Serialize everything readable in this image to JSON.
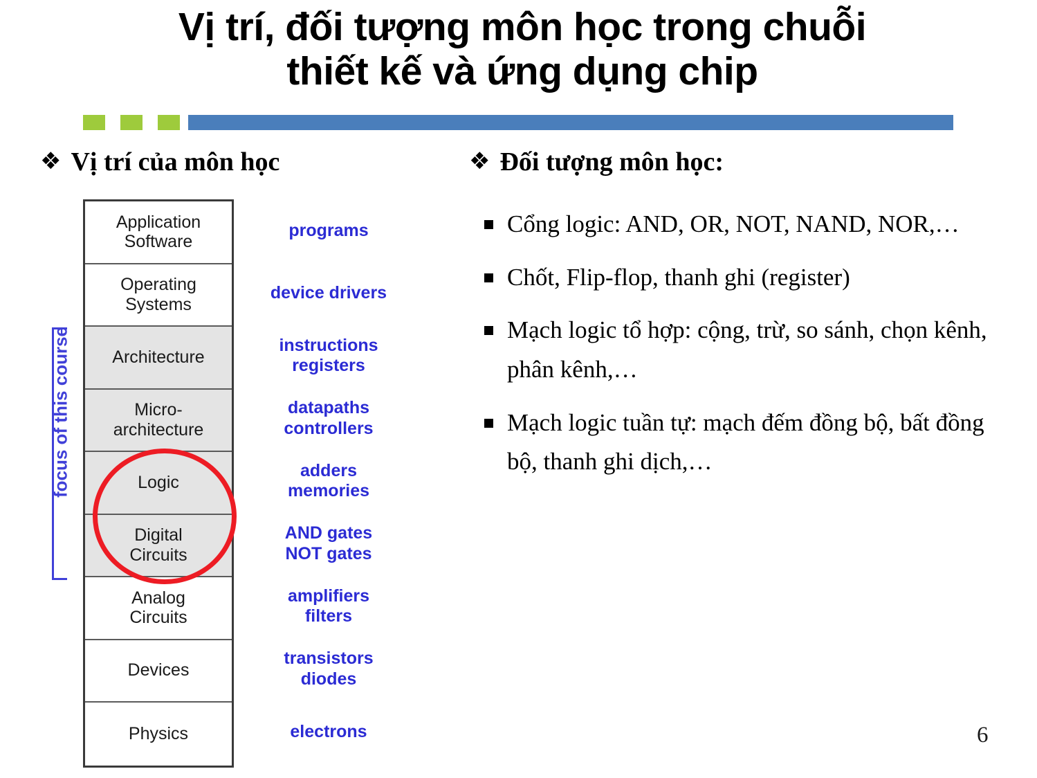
{
  "slide": {
    "title": "Vị trí, đối tượng môn học trong chuỗi\nthiết kế và ứng dụng chip",
    "page_number": "6",
    "colors": {
      "deco_green": "#9ECB3C",
      "deco_blue": "#4A7EBB",
      "annotation_blue": "#2B2BD4",
      "bracket_blue": "#4040D8",
      "highlight_red": "#ED1C24",
      "layer_shaded": "#E4E4E4"
    }
  },
  "left_section": {
    "heading": "Vị trí của môn học",
    "bullet_glyph": "❖",
    "focus_label": "focus of this course",
    "layers": [
      {
        "label": "Application\nSoftware",
        "shaded": false,
        "annotation": "programs"
      },
      {
        "label": "Operating\nSystems",
        "shaded": false,
        "annotation": "device drivers"
      },
      {
        "label": "Architecture",
        "shaded": true,
        "annotation": "instructions\nregisters"
      },
      {
        "label": "Micro-\narchitecture",
        "shaded": true,
        "annotation": "datapaths\ncontrollers"
      },
      {
        "label": "Logic",
        "shaded": true,
        "annotation": "adders\nmemories"
      },
      {
        "label": "Digital\nCircuits",
        "shaded": true,
        "annotation": "AND gates\nNOT gates"
      },
      {
        "label": "Analog\nCircuits",
        "shaded": false,
        "annotation": "amplifiers\nfilters"
      },
      {
        "label": "Devices",
        "shaded": false,
        "annotation": "transistors\ndiodes"
      },
      {
        "label": "Physics",
        "shaded": false,
        "annotation": "electrons"
      }
    ],
    "highlighted_layers": [
      "Logic",
      "Digital Circuits"
    ],
    "focus_layers": [
      "Architecture",
      "Micro-architecture",
      "Logic",
      "Digital Circuits"
    ]
  },
  "right_section": {
    "heading": "Đối tượng môn học:",
    "bullet_glyph": "❖",
    "items": [
      "Cổng logic: AND, OR, NOT, NAND, NOR,…",
      "Chốt, Flip-flop, thanh ghi (register)",
      "Mạch logic tổ hợp: cộng, trừ, so sánh, chọn kênh, phân kênh,…",
      "Mạch logic tuần tự: mạch đếm đồng bộ, bất đồng bộ, thanh ghi dịch,…"
    ]
  }
}
